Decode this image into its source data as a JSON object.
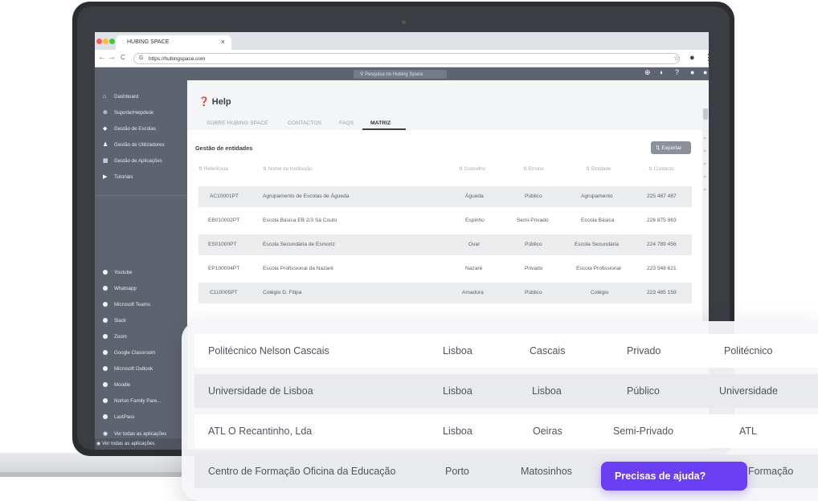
{
  "browser": {
    "tab_title": "HUBING SPACE",
    "tab_close": "×",
    "url": "https://hubingspace.com",
    "nav_back": "←",
    "nav_forward": "→",
    "nav_reload": "C",
    "url_icon": "G"
  },
  "appbar": {
    "search_placeholder": "Pesquisa no Hubing Space"
  },
  "sidebar": {
    "main_items": [
      {
        "label": "Dashboard",
        "icon": "home-icon",
        "glyph": "⌂"
      },
      {
        "label": "Suporte/Helpdesk",
        "icon": "support-icon",
        "glyph": "⊕"
      },
      {
        "label": "Gestão de Escolas",
        "icon": "graduation-cap-icon",
        "glyph": "◆"
      },
      {
        "label": "Gestão de Utilizadores",
        "icon": "users-icon",
        "glyph": "♟"
      },
      {
        "label": "Gestão de Aplicações",
        "icon": "apps-grid-icon",
        "glyph": "▦"
      },
      {
        "label": "Tutoriais",
        "icon": "play-icon",
        "glyph": "▶"
      }
    ],
    "app_items": [
      "Youtube",
      "Whatsapp",
      "Microsoft Teams",
      "Slack",
      "Zoom",
      "Google Classroom",
      "Microsoft Outlook",
      "Moodle",
      "Norton Family Pare...",
      "LastPass"
    ],
    "view_all_1": "Ver todas as aplicações",
    "view_all_2": "Ver todas as aplicações"
  },
  "main": {
    "title": "Help",
    "tabs": [
      "SOBRE HUBING SPACE",
      "CONTACTOS",
      "FAQS",
      "MATRIZ"
    ],
    "active_tab": "MATRIZ",
    "section_title": "Gestão de entidades",
    "export_label": "⇅ Exportar",
    "columns": [
      "⇅ Referência",
      "⇅ Nome da Instituição",
      "⇅ Concelho",
      "⇅ Ensino",
      "⇅ Entidade",
      "⇅ Contacto"
    ],
    "rows": [
      [
        "AC10001PT",
        "Agrupamento de Escolas de Águeda",
        "Águeda",
        "Público",
        "Agrupamento",
        "225 487 487"
      ],
      [
        "EB010002PT",
        "Escola Básica EB 2/3 Sá Couto",
        "Espinho",
        "Semi-Privado",
        "Escola Básica",
        "226 875 963"
      ],
      [
        "ES01000PT",
        "Escola Secundária de Esmoriz",
        "Ovar",
        "Público",
        "Escola Secundária",
        "224 789 456"
      ],
      [
        "EP100004PT",
        "Escola Profissional da Nazaré",
        "Nazaré",
        "Privado",
        "Escola Profissional",
        "223 548 621"
      ],
      [
        "C110005PT",
        "Colégio D. Filipa",
        "Amadora",
        "Público",
        "Colégio",
        "223 485 159"
      ]
    ]
  },
  "zoom": {
    "rows": [
      [
        "Politécnico Nelson Cascais",
        "Lisboa",
        "Cascais",
        "Privado",
        "Politécnico"
      ],
      [
        "Universidade de Lisboa",
        "Lisboa",
        "Lisboa",
        "Público",
        "Universidade"
      ],
      [
        "ATL O Recantinho, Lda",
        "Lisboa",
        "Oeiras",
        "Semi-Privado",
        "ATL"
      ],
      [
        "Centro de Formação Oficina da Educação",
        "Porto",
        "Matosinhos",
        "",
        "Formação"
      ]
    ]
  },
  "help_button": "Precisas de ajuda?",
  "colors": {
    "accent": "#6a3ef2",
    "sidebar": "#5d6470"
  }
}
